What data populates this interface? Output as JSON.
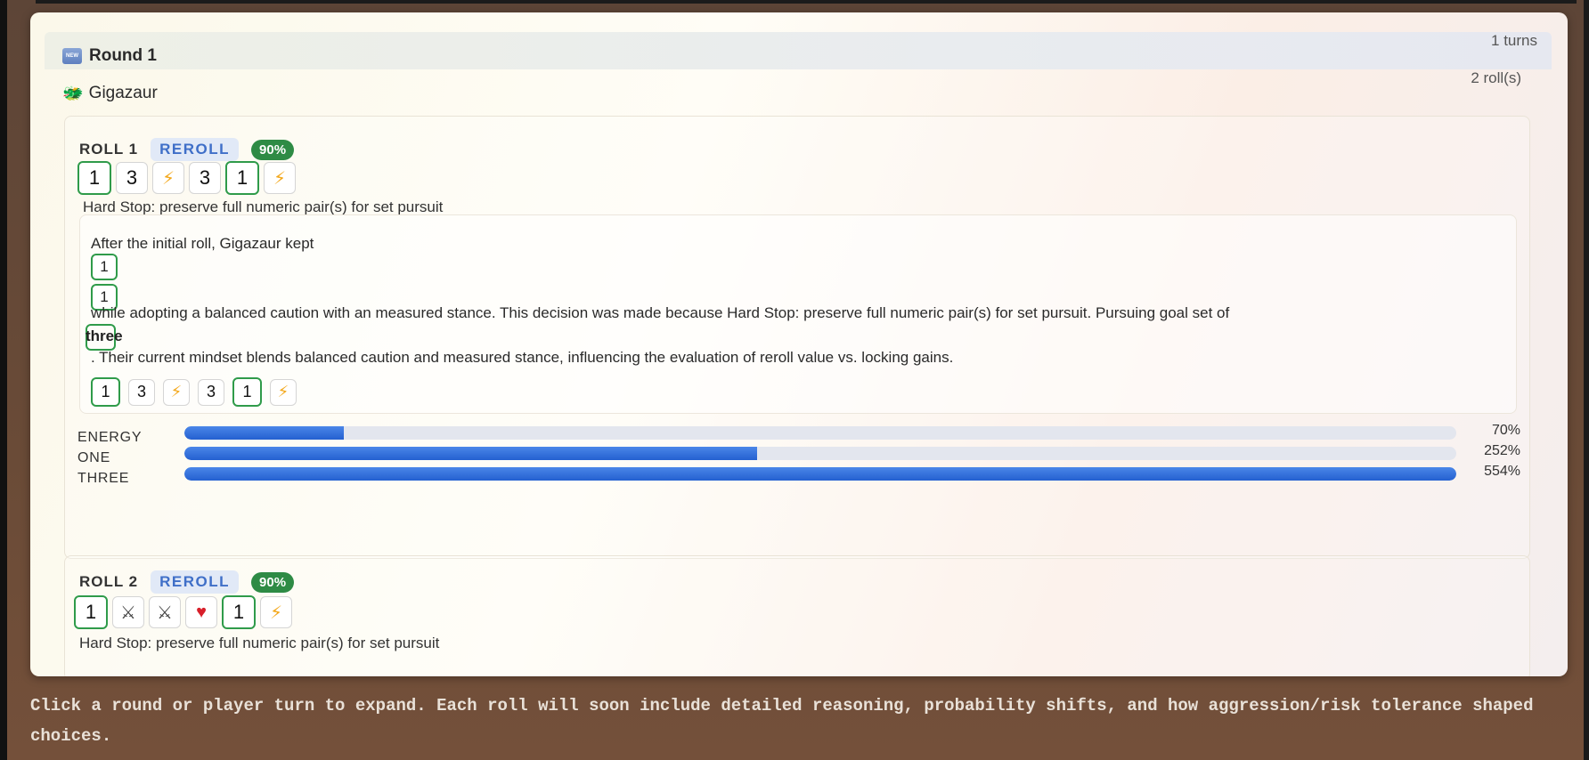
{
  "round": {
    "title": "Round 1",
    "turns": "1 turns",
    "player": "Gigazaur",
    "rolls_count": "2 roll(s)"
  },
  "rolls": [
    {
      "label": "ROLL 1",
      "action": "REROLL",
      "confidence": "90%",
      "dice": [
        "1",
        "3",
        "⚡",
        "3",
        "1",
        "⚡"
      ],
      "kept": [
        true,
        false,
        false,
        false,
        true,
        false
      ],
      "reason": "Hard Stop: preserve full numeric pair(s) for set pursuit",
      "explanation": {
        "line1": "After the initial roll, Gigazaur kept",
        "kept_values": [
          "1",
          "1"
        ],
        "line2": "while adopting a balanced caution with an measured stance. This decision was made because Hard Stop: preserve full numeric pair(s) for set pursuit. Pursuing goal set of",
        "goal": "three",
        "line3": ". Their current mindset blends balanced caution and measured stance, influencing the evaluation of reroll value vs. locking gains."
      },
      "probabilities": [
        {
          "label": "ENERGY",
          "value": "70%",
          "fill": 0.125
        },
        {
          "label": "ONE",
          "value": "252%",
          "fill": 0.45
        },
        {
          "label": "THREE",
          "value": "554%",
          "fill": 1.0
        }
      ]
    },
    {
      "label": "ROLL 2",
      "action": "REROLL",
      "confidence": "90%",
      "dice": [
        "1",
        "⚔",
        "⚔",
        "♥",
        "1",
        "⚡"
      ],
      "kept": [
        true,
        false,
        false,
        false,
        true,
        false
      ],
      "reason": "Hard Stop: preserve full numeric pair(s) for set pursuit"
    }
  ],
  "footer": "Click a round or player turn to expand. Each roll will soon include detailed reasoning, probability shifts, and how aggression/risk tolerance shaped choices."
}
